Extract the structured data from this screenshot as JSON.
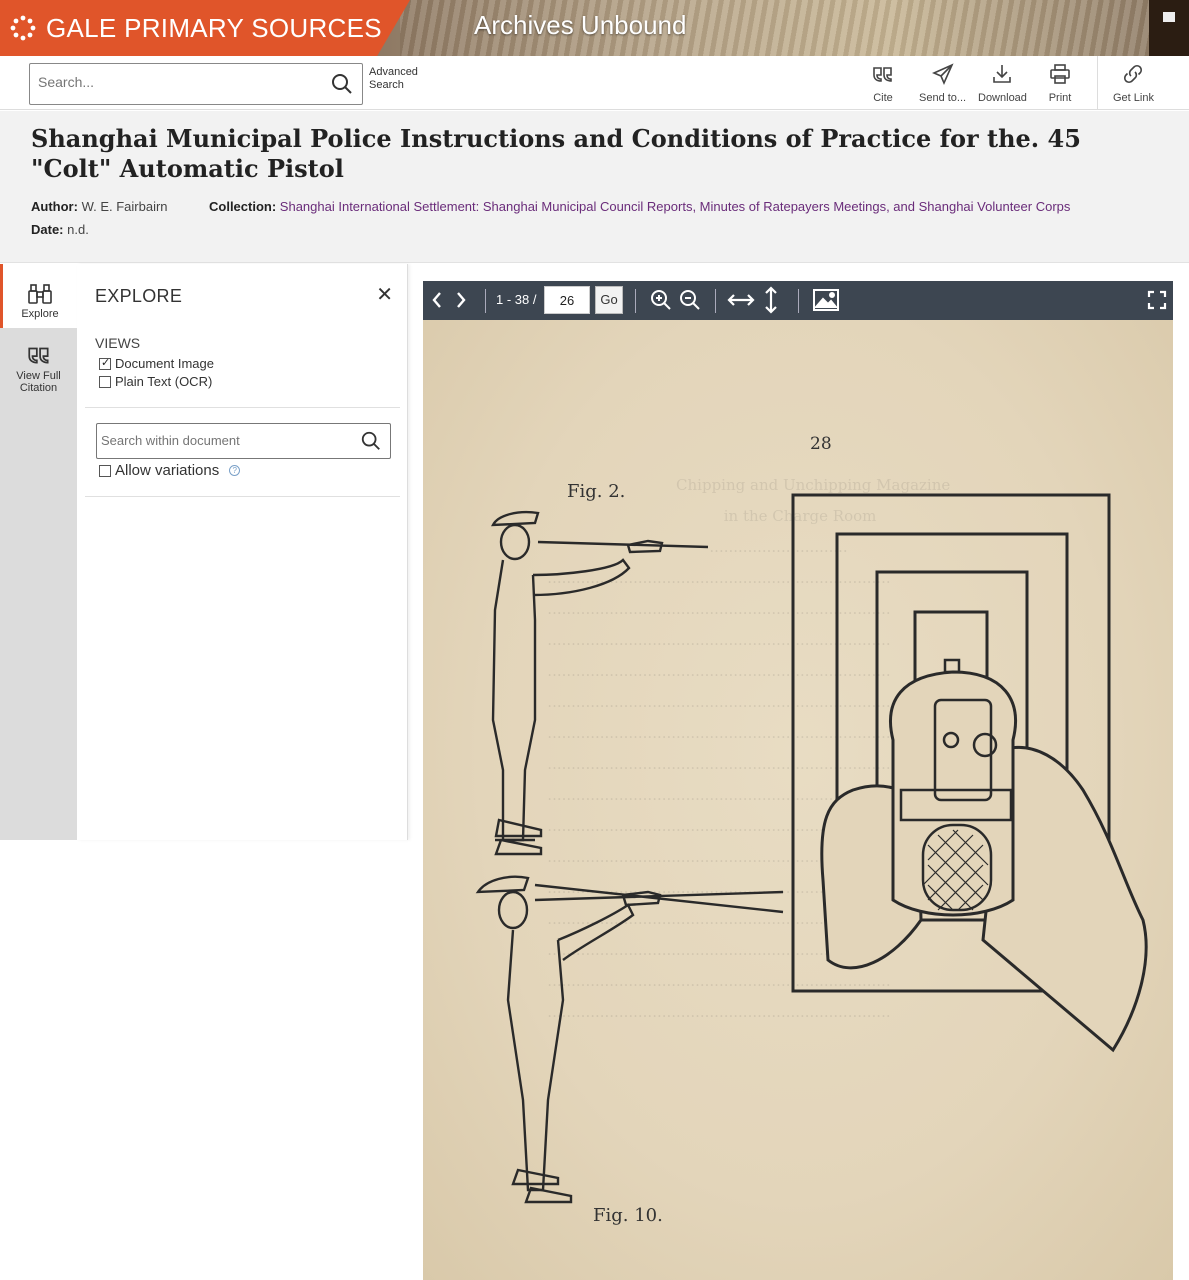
{
  "banner": {
    "brand": "GALE PRIMARY SOURCES",
    "collection": "Archives Unbound",
    "brand_color": "#e0552a"
  },
  "search": {
    "placeholder": "Search...",
    "advanced_label": "Advanced Search"
  },
  "tools": {
    "cite": "Cite",
    "send": "Send to...",
    "download": "Download",
    "print": "Print",
    "get_link": "Get Link"
  },
  "document": {
    "title": "Shanghai Municipal Police Instructions and Conditions of Practice for the. 45 \"Colt\" Automatic Pistol",
    "author_label": "Author:",
    "author": "W. E. Fairbairn",
    "collection_label": "Collection:",
    "collection": "Shanghai International Settlement: Shanghai Municipal Council Reports, Minutes of Ratepayers Meetings, and Shanghai Volunteer Corps",
    "date_label": "Date:",
    "date": "n.d."
  },
  "rail": {
    "explore": "Explore",
    "citation": "View Full Citation"
  },
  "explore": {
    "title": "EXPLORE",
    "views_label": "VIEWS",
    "views": [
      {
        "label": "Document Image",
        "checked": true
      },
      {
        "label": "Plain Text (OCR)",
        "checked": false
      }
    ],
    "search_placeholder": "Search within document",
    "allow_variations": "Allow variations"
  },
  "viewer": {
    "page_range": "1 - 38 /",
    "page_value": "26",
    "go_label": "Go"
  },
  "page_image": {
    "page_number": "28",
    "fig_top": "Fig. 2.",
    "fig_bottom": "Fig. 10."
  }
}
